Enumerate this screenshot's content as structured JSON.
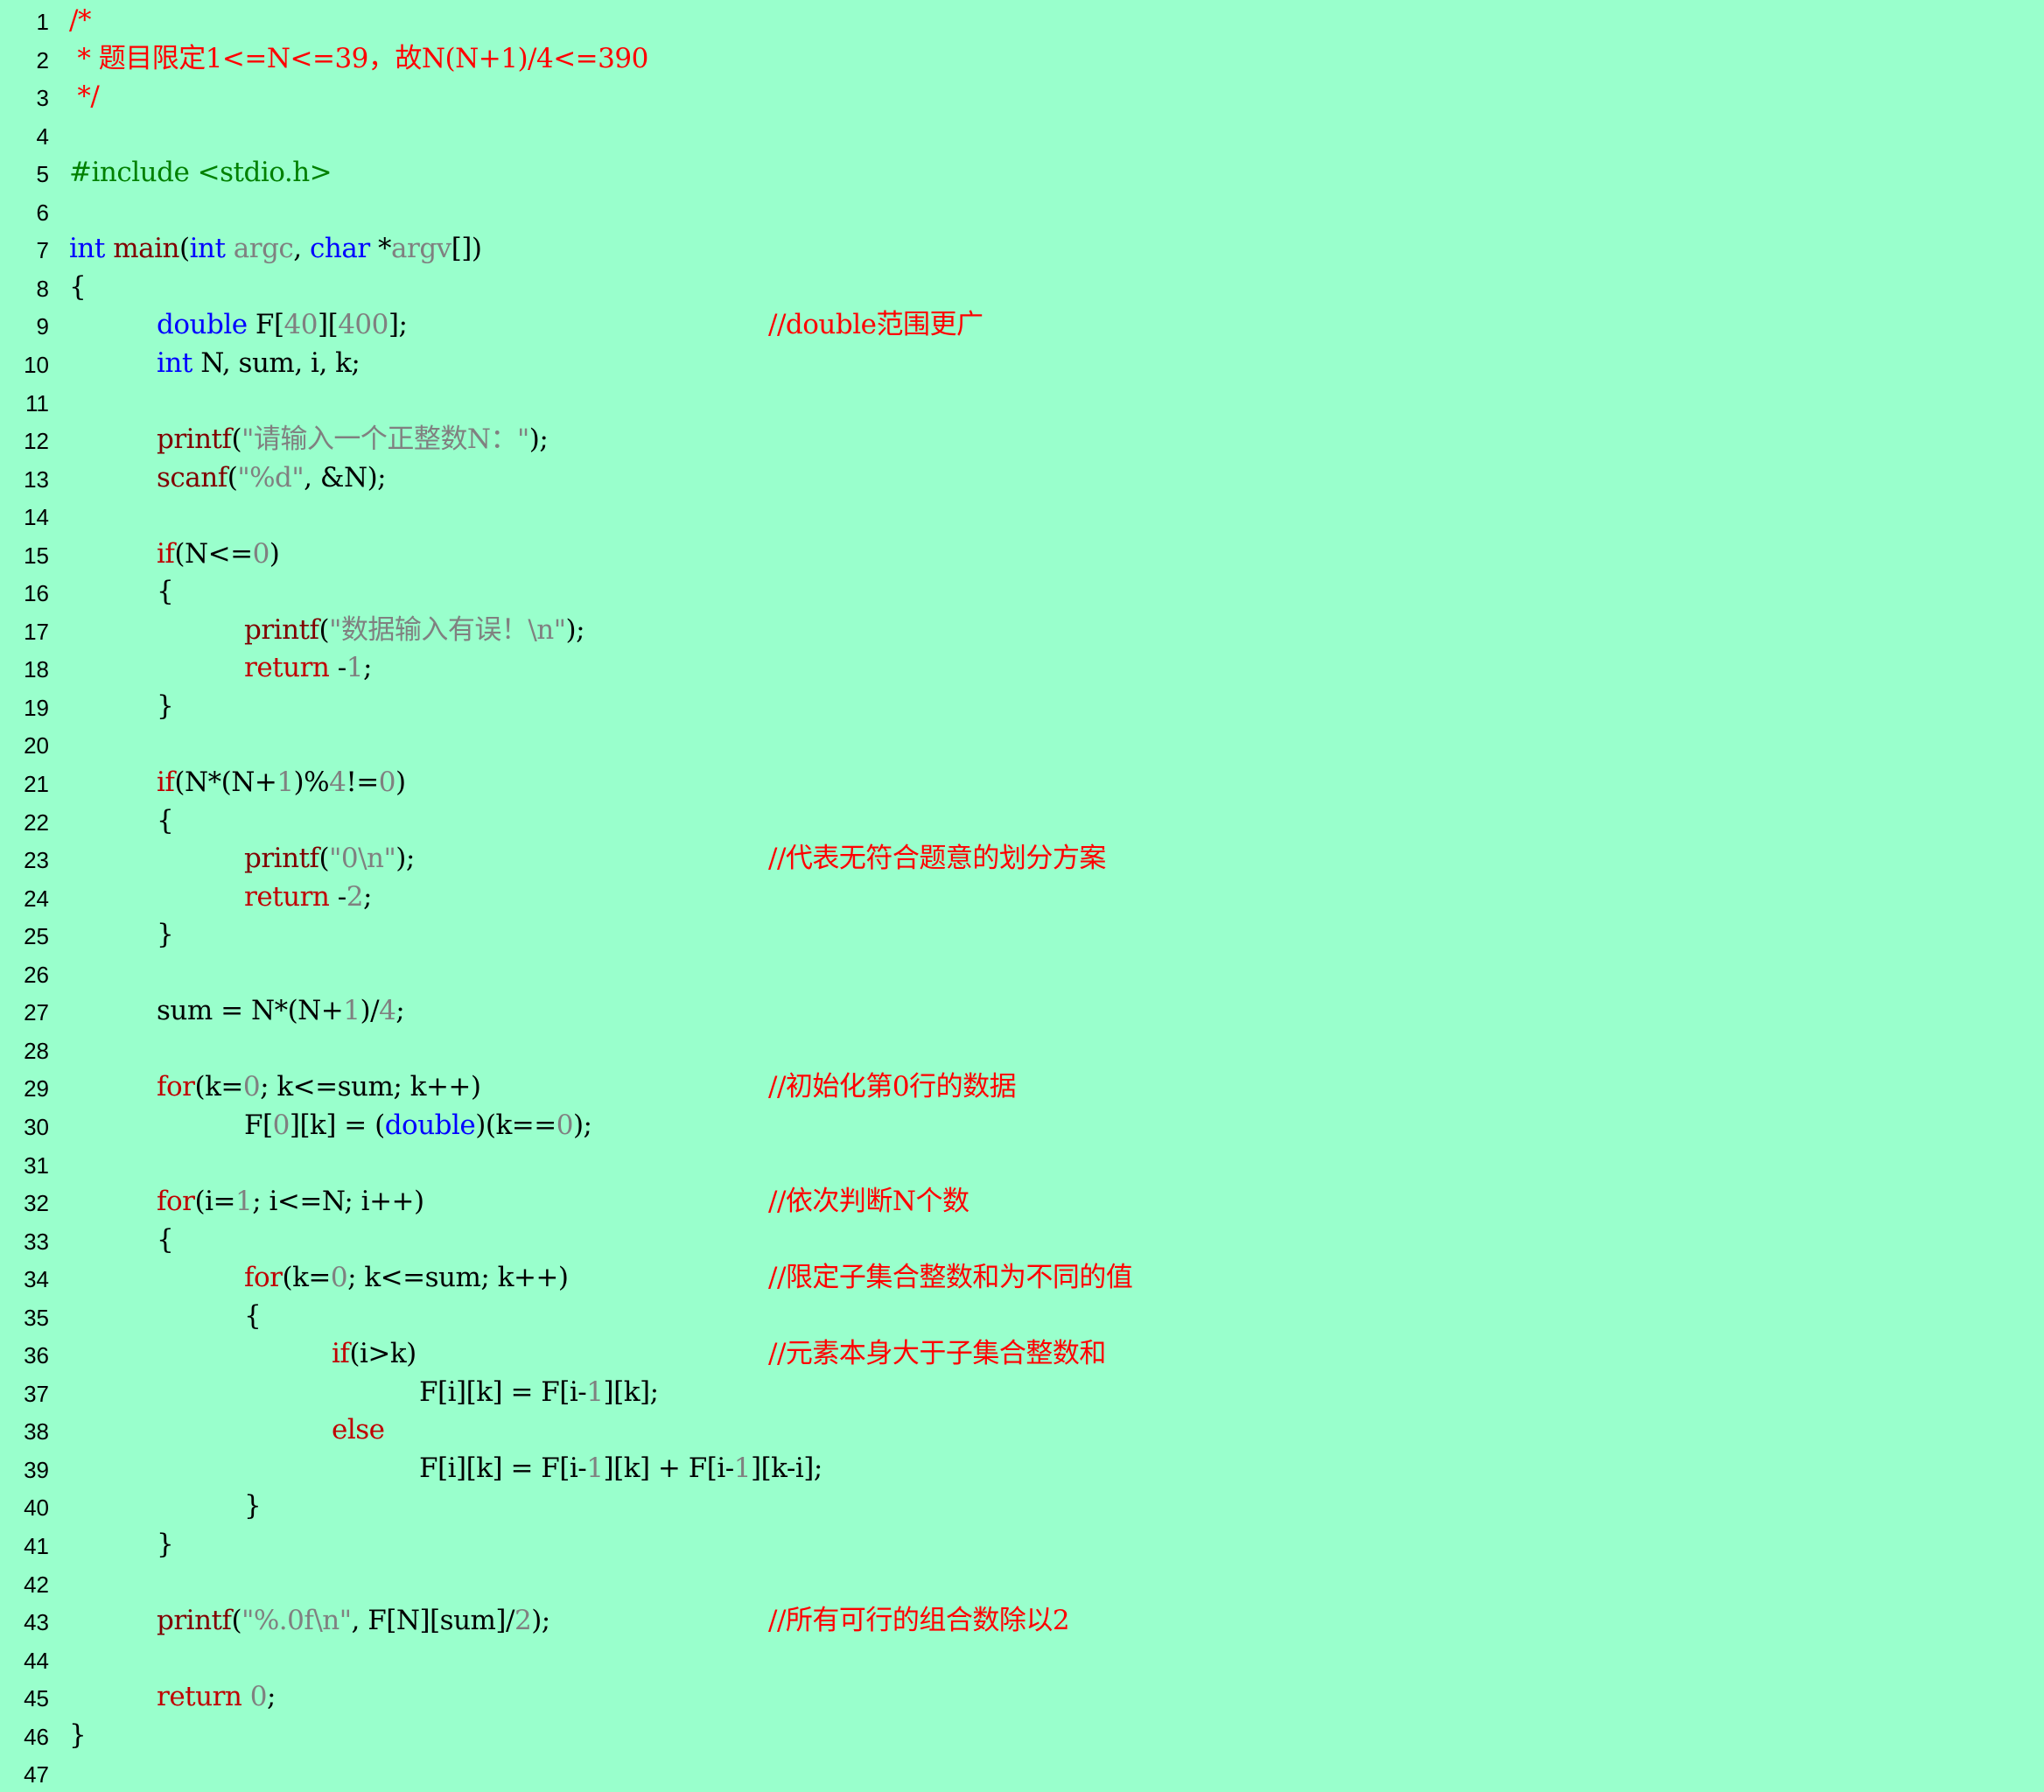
{
  "editor": {
    "lines": [
      {
        "n": "1",
        "indent": 0,
        "tokens": [
          {
            "t": "/*",
            "k": "cmt"
          }
        ]
      },
      {
        "n": "2",
        "indent": 0,
        "tokens": [
          {
            "t": " * 题目限定1<=N<=39，故N(N+1)/4<=390",
            "k": "cmt"
          }
        ]
      },
      {
        "n": "3",
        "indent": 0,
        "tokens": [
          {
            "t": " */",
            "k": "cmt"
          }
        ]
      },
      {
        "n": "4",
        "indent": 0,
        "tokens": []
      },
      {
        "n": "5",
        "indent": 0,
        "tokens": [
          {
            "t": "#include <stdio.h>",
            "k": "pp"
          }
        ]
      },
      {
        "n": "6",
        "indent": 0,
        "tokens": []
      },
      {
        "n": "7",
        "indent": 0,
        "tokens": [
          {
            "t": "int",
            "k": "kw"
          },
          {
            "t": " ",
            "k": "id"
          },
          {
            "t": "main",
            "k": "fn"
          },
          {
            "t": "(",
            "k": "op"
          },
          {
            "t": "int",
            "k": "kw"
          },
          {
            "t": " ",
            "k": "id"
          },
          {
            "t": "argc",
            "k": "par"
          },
          {
            "t": ", ",
            "k": "op"
          },
          {
            "t": "char",
            "k": "kw"
          },
          {
            "t": " *",
            "k": "op"
          },
          {
            "t": "argv",
            "k": "par"
          },
          {
            "t": "[])",
            "k": "op"
          }
        ]
      },
      {
        "n": "8",
        "indent": 0,
        "tokens": [
          {
            "t": "{",
            "k": "op"
          }
        ]
      },
      {
        "n": "9",
        "indent": 1,
        "tokens": [
          {
            "t": "double",
            "k": "kw"
          },
          {
            "t": " F[",
            "k": "id"
          },
          {
            "t": "40",
            "k": "num"
          },
          {
            "t": "][",
            "k": "op"
          },
          {
            "t": "400",
            "k": "num"
          },
          {
            "t": "];",
            "k": "op"
          }
        ],
        "comment": "//double范围更广"
      },
      {
        "n": "10",
        "indent": 1,
        "tokens": [
          {
            "t": "int",
            "k": "kw"
          },
          {
            "t": " N, sum, i, k;",
            "k": "id"
          }
        ]
      },
      {
        "n": "11",
        "indent": 0,
        "tokens": []
      },
      {
        "n": "12",
        "indent": 1,
        "tokens": [
          {
            "t": "printf",
            "k": "fn"
          },
          {
            "t": "(",
            "k": "op"
          },
          {
            "t": "\"请输入一个正整数N：\"",
            "k": "str"
          },
          {
            "t": ");",
            "k": "op"
          }
        ]
      },
      {
        "n": "13",
        "indent": 1,
        "tokens": [
          {
            "t": "scanf",
            "k": "fn"
          },
          {
            "t": "(",
            "k": "op"
          },
          {
            "t": "\"%d\"",
            "k": "str"
          },
          {
            "t": ", &N);",
            "k": "id"
          }
        ]
      },
      {
        "n": "14",
        "indent": 0,
        "tokens": []
      },
      {
        "n": "15",
        "indent": 1,
        "tokens": [
          {
            "t": "if",
            "k": "ctl"
          },
          {
            "t": "(N<=",
            "k": "id"
          },
          {
            "t": "0",
            "k": "num"
          },
          {
            "t": ")",
            "k": "op"
          }
        ]
      },
      {
        "n": "16",
        "indent": 1,
        "tokens": [
          {
            "t": "{",
            "k": "op"
          }
        ]
      },
      {
        "n": "17",
        "indent": 2,
        "tokens": [
          {
            "t": "printf",
            "k": "fn"
          },
          {
            "t": "(",
            "k": "op"
          },
          {
            "t": "\"数据输入有误！\\n\"",
            "k": "str"
          },
          {
            "t": ");",
            "k": "op"
          }
        ]
      },
      {
        "n": "18",
        "indent": 2,
        "tokens": [
          {
            "t": "return",
            "k": "ctl"
          },
          {
            "t": " -",
            "k": "op"
          },
          {
            "t": "1",
            "k": "num"
          },
          {
            "t": ";",
            "k": "op"
          }
        ]
      },
      {
        "n": "19",
        "indent": 1,
        "tokens": [
          {
            "t": "}",
            "k": "op"
          }
        ]
      },
      {
        "n": "20",
        "indent": 0,
        "tokens": []
      },
      {
        "n": "21",
        "indent": 1,
        "tokens": [
          {
            "t": "if",
            "k": "ctl"
          },
          {
            "t": "(N*(N+",
            "k": "id"
          },
          {
            "t": "1",
            "k": "num"
          },
          {
            "t": ")%",
            "k": "op"
          },
          {
            "t": "4",
            "k": "num"
          },
          {
            "t": "!=",
            "k": "op"
          },
          {
            "t": "0",
            "k": "num"
          },
          {
            "t": ")",
            "k": "op"
          }
        ]
      },
      {
        "n": "22",
        "indent": 1,
        "tokens": [
          {
            "t": "{",
            "k": "op"
          }
        ]
      },
      {
        "n": "23",
        "indent": 2,
        "tokens": [
          {
            "t": "printf",
            "k": "fn"
          },
          {
            "t": "(",
            "k": "op"
          },
          {
            "t": "\"0\\n\"",
            "k": "str"
          },
          {
            "t": ");",
            "k": "op"
          }
        ],
        "comment": "//代表无符合题意的划分方案"
      },
      {
        "n": "24",
        "indent": 2,
        "tokens": [
          {
            "t": "return",
            "k": "ctl"
          },
          {
            "t": " -",
            "k": "op"
          },
          {
            "t": "2",
            "k": "num"
          },
          {
            "t": ";",
            "k": "op"
          }
        ]
      },
      {
        "n": "25",
        "indent": 1,
        "tokens": [
          {
            "t": "}",
            "k": "op"
          }
        ]
      },
      {
        "n": "26",
        "indent": 0,
        "tokens": []
      },
      {
        "n": "27",
        "indent": 1,
        "tokens": [
          {
            "t": "sum = N*(N+",
            "k": "id"
          },
          {
            "t": "1",
            "k": "num"
          },
          {
            "t": ")/",
            "k": "op"
          },
          {
            "t": "4",
            "k": "num"
          },
          {
            "t": ";",
            "k": "op"
          }
        ]
      },
      {
        "n": "28",
        "indent": 0,
        "tokens": []
      },
      {
        "n": "29",
        "indent": 1,
        "tokens": [
          {
            "t": "for",
            "k": "ctl"
          },
          {
            "t": "(k=",
            "k": "id"
          },
          {
            "t": "0",
            "k": "num"
          },
          {
            "t": "; k<=sum; k++)",
            "k": "id"
          }
        ],
        "comment": "//初始化第0行的数据"
      },
      {
        "n": "30",
        "indent": 2,
        "tokens": [
          {
            "t": "F[",
            "k": "id"
          },
          {
            "t": "0",
            "k": "num"
          },
          {
            "t": "][k] = (",
            "k": "id"
          },
          {
            "t": "double",
            "k": "kw"
          },
          {
            "t": ")(k==",
            "k": "id"
          },
          {
            "t": "0",
            "k": "num"
          },
          {
            "t": ");",
            "k": "op"
          }
        ]
      },
      {
        "n": "31",
        "indent": 0,
        "tokens": []
      },
      {
        "n": "32",
        "indent": 1,
        "tokens": [
          {
            "t": "for",
            "k": "ctl"
          },
          {
            "t": "(i=",
            "k": "id"
          },
          {
            "t": "1",
            "k": "num"
          },
          {
            "t": "; i<=N; i++)",
            "k": "id"
          }
        ],
        "comment": "//依次判断N个数"
      },
      {
        "n": "33",
        "indent": 1,
        "tokens": [
          {
            "t": "{",
            "k": "op"
          }
        ]
      },
      {
        "n": "34",
        "indent": 2,
        "tokens": [
          {
            "t": "for",
            "k": "ctl"
          },
          {
            "t": "(k=",
            "k": "id"
          },
          {
            "t": "0",
            "k": "num"
          },
          {
            "t": "; k<=sum; k++)",
            "k": "id"
          }
        ],
        "comment": "//限定子集合整数和为不同的值"
      },
      {
        "n": "35",
        "indent": 2,
        "tokens": [
          {
            "t": "{",
            "k": "op"
          }
        ]
      },
      {
        "n": "36",
        "indent": 3,
        "tokens": [
          {
            "t": "if",
            "k": "ctl"
          },
          {
            "t": "(i>k)",
            "k": "id"
          }
        ],
        "comment": "//元素本身大于子集合整数和"
      },
      {
        "n": "37",
        "indent": 4,
        "tokens": [
          {
            "t": "F[i][k] = F[i-",
            "k": "id"
          },
          {
            "t": "1",
            "k": "num"
          },
          {
            "t": "][k];",
            "k": "id"
          }
        ]
      },
      {
        "n": "38",
        "indent": 3,
        "tokens": [
          {
            "t": "else",
            "k": "ctl"
          }
        ]
      },
      {
        "n": "39",
        "indent": 4,
        "tokens": [
          {
            "t": "F[i][k] = F[i-",
            "k": "id"
          },
          {
            "t": "1",
            "k": "num"
          },
          {
            "t": "][k] + F[i-",
            "k": "id"
          },
          {
            "t": "1",
            "k": "num"
          },
          {
            "t": "][k-i];",
            "k": "id"
          }
        ]
      },
      {
        "n": "40",
        "indent": 2,
        "tokens": [
          {
            "t": "}",
            "k": "op"
          }
        ]
      },
      {
        "n": "41",
        "indent": 1,
        "tokens": [
          {
            "t": "}",
            "k": "op"
          }
        ]
      },
      {
        "n": "42",
        "indent": 0,
        "tokens": []
      },
      {
        "n": "43",
        "indent": 1,
        "tokens": [
          {
            "t": "printf",
            "k": "fn"
          },
          {
            "t": "(",
            "k": "op"
          },
          {
            "t": "\"%.0f\\n\"",
            "k": "str"
          },
          {
            "t": ", F[N][sum]/",
            "k": "id"
          },
          {
            "t": "2",
            "k": "num"
          },
          {
            "t": ");",
            "k": "op"
          }
        ],
        "comment": "//所有可行的组合数除以2"
      },
      {
        "n": "44",
        "indent": 0,
        "tokens": []
      },
      {
        "n": "45",
        "indent": 1,
        "tokens": [
          {
            "t": "return",
            "k": "ctl"
          },
          {
            "t": " ",
            "k": "id"
          },
          {
            "t": "0",
            "k": "num"
          },
          {
            "t": ";",
            "k": "op"
          }
        ]
      },
      {
        "n": "46",
        "indent": 0,
        "tokens": [
          {
            "t": "}",
            "k": "op"
          }
        ]
      },
      {
        "n": "47",
        "indent": 0,
        "tokens": []
      }
    ]
  }
}
